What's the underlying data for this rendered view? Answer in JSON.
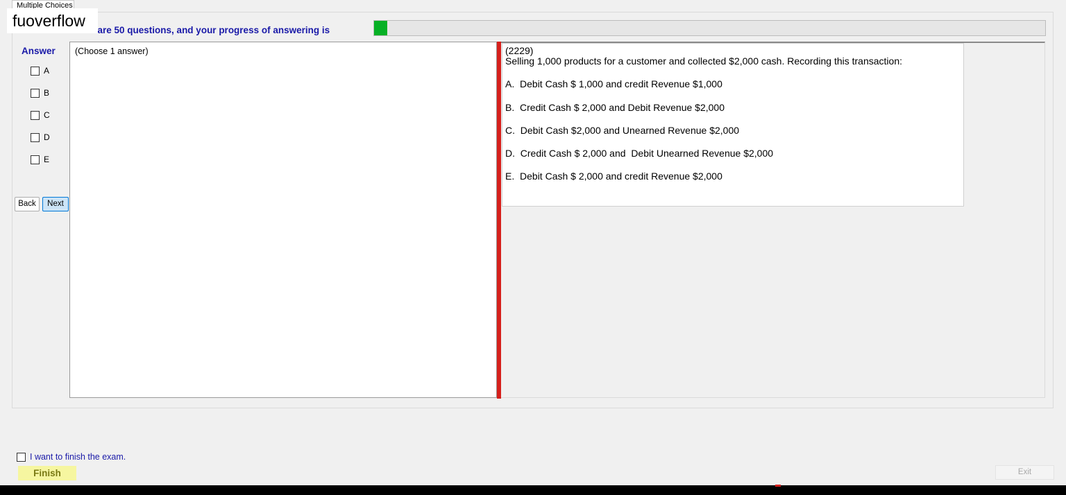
{
  "tab": {
    "label": "Multiple Choices"
  },
  "watermark": {
    "text": "fuoverflow"
  },
  "header": {
    "progress_text": "There are 50 questions, and your progress of answering is",
    "progress_fraction": 0.02,
    "progress_color": "#06b025"
  },
  "answer_panel": {
    "label": "Answer",
    "choices": [
      "A",
      "B",
      "C",
      "D",
      "E"
    ],
    "back_label": "Back",
    "next_label": "Next"
  },
  "answer_box": {
    "hint": "(Choose 1 answer)"
  },
  "question": {
    "id": "(2229)",
    "text": "Selling 1,000 products for a customer and collected $2,000 cash. Recording this transaction:",
    "options": [
      "A.  Debit Cash $ 1,000 and credit Revenue $1,000",
      "B.  Credit Cash $ 2,000 and Debit Revenue $2,000",
      "C.  Debit Cash $2,000 and Unearned Revenue $2,000",
      "D.  Credit Cash $ 2,000 and  Debit Unearned Revenue $2,000",
      "E.  Debit Cash $ 2,000 and credit Revenue $2,000"
    ]
  },
  "footer": {
    "finish_checkbox_label": "I want to finish the exam.",
    "finish_label": "Finish",
    "exit_label": "Exit"
  },
  "colors": {
    "heading_blue": "#1a1aa8",
    "splitter_red": "#d6201c",
    "finish_bg": "#f6f6a0"
  }
}
